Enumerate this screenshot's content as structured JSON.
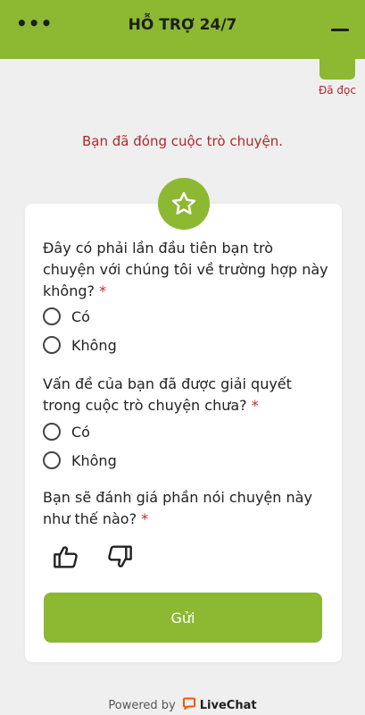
{
  "header": {
    "title": "HỖ TRỢ 24/7",
    "menu_icon": "more-horizontal-icon",
    "minimize_icon": "minimize-icon"
  },
  "read_status": "Đã đọc",
  "closed_message": "Bạn đã đóng cuộc trò chuyện.",
  "survey": {
    "badge_icon": "star-icon",
    "questions": [
      {
        "text": "Đây có phải lần đầu tiên bạn trò chuyện với chúng tôi về trường hợp này không?",
        "required": "*",
        "options": [
          "Có",
          "Không"
        ]
      },
      {
        "text": "Vấn đề của bạn đã được giải quyết trong cuộc trò chuyện chưa?",
        "required": "*",
        "options": [
          "Có",
          "Không"
        ]
      },
      {
        "text": "Bạn sẽ đánh giá phần nói chuyện này như thế nào?",
        "required": "*",
        "rating_icons": [
          "thumbs-up-icon",
          "thumbs-down-icon"
        ]
      }
    ],
    "submit_label": "Gửi"
  },
  "footer": {
    "powered_by": "Powered by",
    "brand": "LiveChat"
  },
  "colors": {
    "accent": "#8cb832",
    "alert": "#b0282b"
  }
}
